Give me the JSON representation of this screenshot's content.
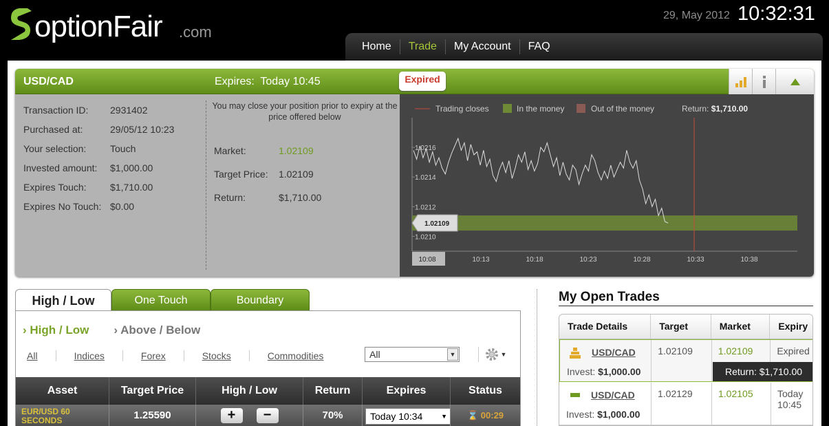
{
  "header": {
    "logo_text": "optionFair",
    "logo_suffix": ".com",
    "date": "29, May 2012",
    "time": "10:32:31",
    "nav": [
      {
        "label": "Home",
        "active": false
      },
      {
        "label": "Trade",
        "active": true
      },
      {
        "label": "My Account",
        "active": false
      },
      {
        "label": "FAQ",
        "active": false
      }
    ]
  },
  "trade": {
    "pair": "USD/CAD",
    "expires_label": "Expires:",
    "expires_value": "Today 10:45",
    "badge": "Expired",
    "details": [
      {
        "label": "Transaction ID:",
        "value": "2931402"
      },
      {
        "label": "Purchased at:",
        "value": "29/05/12 10:23"
      },
      {
        "label": "Your selection:",
        "value": "Touch"
      },
      {
        "label": "Invested amount:",
        "value": "$1,000.00"
      },
      {
        "label": "Expires Touch:",
        "value": "$1,710.00"
      },
      {
        "label": "Expires No Touch:",
        "value": "$0.00"
      }
    ],
    "note": "You may close your position prior to expiry at the price offered below",
    "market_label": "Market:",
    "market_value": "1.02109",
    "target_label": "Target Price:",
    "target_value": "1.02109",
    "return_label": "Return:",
    "return_value": "$1,710.00"
  },
  "chart_data": {
    "type": "line",
    "legend": [
      "Trading closes",
      "In the money",
      "Out of the money"
    ],
    "return_label": "Return:",
    "return_value": "$1,710.00",
    "current_label": "1.02109",
    "y_ticks": [
      "1.0216",
      "1.0214",
      "1.0212",
      "1.0210"
    ],
    "x_ticks": [
      "10:08",
      "10:13",
      "10:18",
      "10:23",
      "10:28",
      "10:33",
      "10:38"
    ],
    "ylim": [
      1.0209,
      1.0218
    ],
    "target": 1.02109,
    "series": [
      {
        "values": [
          1.02158,
          1.02152,
          1.02161,
          1.02153,
          1.02159,
          1.0215,
          1.02157,
          1.02148,
          1.02153,
          1.02146,
          1.02142,
          1.0215,
          1.02156,
          1.02161,
          1.02166,
          1.02158,
          1.02163,
          1.02151,
          1.02162,
          1.02155,
          1.02157,
          1.02148,
          1.02158,
          1.02147,
          1.02152,
          1.02141,
          1.02137,
          1.02145,
          1.0215,
          1.02143,
          1.02151,
          1.02139,
          1.02146,
          1.02155,
          1.0215,
          1.02157,
          1.02145,
          1.02151,
          1.02144,
          1.02149,
          1.0216,
          1.02157,
          1.02163,
          1.02155,
          1.02147,
          1.02153,
          1.02141,
          1.0215,
          1.02142,
          1.02138,
          1.02148,
          1.02145,
          1.02135,
          1.02142,
          1.02148,
          1.02144,
          1.02155,
          1.02151,
          1.02143,
          1.02138,
          1.02144,
          1.02139,
          1.02148,
          1.0214,
          1.02145,
          1.0215,
          1.02146,
          1.02158,
          1.0215,
          1.02146,
          1.02151,
          1.02138,
          1.02132,
          1.02122,
          1.02128,
          1.0212,
          1.02125,
          1.02114,
          1.02119,
          1.0211,
          1.02109
        ]
      }
    ]
  },
  "tabs": [
    "High / Low",
    "One Touch",
    "Boundary"
  ],
  "subtabs": [
    "High / Low",
    "Above / Below"
  ],
  "filters": [
    "All",
    "Indices",
    "Forex",
    "Stocks",
    "Commodities"
  ],
  "filter_select": "All",
  "table": {
    "headers": [
      "Asset",
      "Target Price",
      "High / Low",
      "Return",
      "Expires",
      "Status"
    ],
    "row": {
      "asset": "EUR/USD 60 SECONDS",
      "target": "1.25590",
      "plus": "+",
      "minus": "−",
      "return": "70%",
      "expires": "Today 10:34",
      "status": "00:29"
    }
  },
  "open_trades": {
    "title": "My Open Trades",
    "headers": [
      "Trade Details",
      "Target",
      "Market",
      "Expiry"
    ],
    "invest_label": "Invest:",
    "rows": [
      {
        "pair": "USD/CAD",
        "invest": "$1,000.00",
        "target": "1.02109",
        "market": "1.02109",
        "expiry": "Expired",
        "return": "Return: $1,710.00"
      },
      {
        "pair": "USD/CAD",
        "invest": "$1,000.00",
        "target": "1.02129",
        "market": "1.02105",
        "expiry": "Today 10:45"
      }
    ]
  },
  "colors": {
    "brand_green": "#7aa52a",
    "expired_red": "#c93b2b"
  }
}
